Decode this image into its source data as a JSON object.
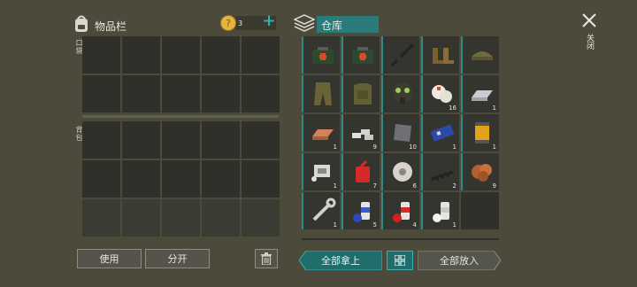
{
  "inventory": {
    "title": "物品栏",
    "coin_count": "3",
    "add_symbol": "+",
    "section_pocket": "口袋",
    "section_backpack": "背包"
  },
  "warehouse": {
    "title": "仓库",
    "items": [
      {
        "icon": "medkit-case-icon",
        "qty": ""
      },
      {
        "icon": "medkit-case-icon",
        "qty": ""
      },
      {
        "icon": "rifle-icon",
        "qty": ""
      },
      {
        "icon": "boots-icon",
        "qty": ""
      },
      {
        "icon": "camo-cap-icon",
        "qty": ""
      },
      {
        "icon": "camo-pants-icon",
        "qty": ""
      },
      {
        "icon": "camo-vest-icon",
        "qty": ""
      },
      {
        "icon": "gas-mask-icon",
        "qty": ""
      },
      {
        "icon": "bandage-icon",
        "qty": "16"
      },
      {
        "icon": "steel-ingot-icon",
        "qty": "1"
      },
      {
        "icon": "copper-ingot-icon",
        "qty": "1"
      },
      {
        "icon": "silver-bars-icon",
        "qty": "9"
      },
      {
        "icon": "metal-plate-icon",
        "qty": "10"
      },
      {
        "icon": "circuit-board-icon",
        "qty": "1"
      },
      {
        "icon": "filter-icon",
        "qty": "1"
      },
      {
        "icon": "engine-part-icon",
        "qty": "1"
      },
      {
        "icon": "gas-can-icon",
        "qty": "7"
      },
      {
        "icon": "wire-spool-icon",
        "qty": "6"
      },
      {
        "icon": "spring-icon",
        "qty": "2"
      },
      {
        "icon": "copper-ore-icon",
        "qty": "9"
      },
      {
        "icon": "wrench-icon",
        "qty": "1"
      },
      {
        "icon": "spray-can-blue-icon",
        "qty": "5"
      },
      {
        "icon": "spray-can-red-icon",
        "qty": "4"
      },
      {
        "icon": "spray-can-white-icon",
        "qty": "1"
      },
      {
        "icon": "",
        "qty": ""
      }
    ]
  },
  "buttons": {
    "use": "使用",
    "split": "分开",
    "take_all": "全部拿上",
    "put_all": "全部放入",
    "close": "关闭"
  },
  "colors": {
    "accent": "#2e8a88",
    "background": "#4c4b3b",
    "slot": "#2f302a"
  }
}
